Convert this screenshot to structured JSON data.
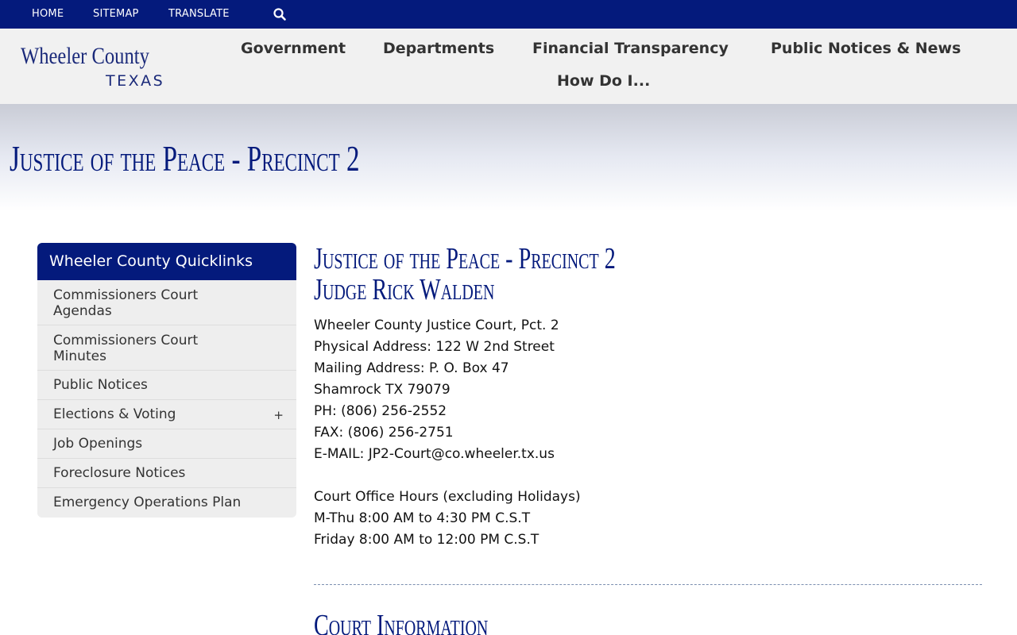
{
  "topbar": {
    "links": [
      "HOME",
      "SITEMAP",
      "TRANSLATE"
    ],
    "search_icon": "search-icon"
  },
  "logo": {
    "line1": "Wheeler County",
    "line2": "TEXAS"
  },
  "nav": {
    "items": [
      "Government",
      "Departments",
      "Financial Transparency",
      "Public Notices & News",
      "How Do I..."
    ]
  },
  "banner": {
    "title": "Justice of the Peace -  Precinct 2"
  },
  "sidebar": {
    "heading": "Wheeler County Quicklinks",
    "items": [
      {
        "label": "Commissioners Court Agendas"
      },
      {
        "label": "Commissioners Court Minutes"
      },
      {
        "label": "Public Notices"
      },
      {
        "label": "Elections & Voting",
        "expand": "+"
      },
      {
        "label": "Job Openings"
      },
      {
        "label": "Foreclosure Notices"
      },
      {
        "label": "Emergency Operations Plan"
      }
    ]
  },
  "main": {
    "title": "Justice of the Peace -  Precinct 2",
    "subtitle": "Judge Rick Walden",
    "contact": [
      "Wheeler County Justice Court, Pct. 2",
      "Physical Address: 122 W 2nd Street",
      "Mailing Address: P. O. Box 47",
      "Shamrock TX 79079",
      "PH: (806) 256-2552",
      "FAX: (806) 256-2751",
      "E-MAIL: JP2-Court@co.wheeler.tx.us"
    ],
    "hours": [
      "Court Office Hours (excluding Holidays)",
      "M-Thu 8:00 AM to 4:30 PM C.S.T",
      "Friday 8:00 AM to 12:00 PM C.S.T"
    ],
    "section_heading": "Court Information"
  },
  "colors": {
    "primary": "#041a7c",
    "header_bg": "#f1f1f1",
    "sidebar_bg": "#eeeeee"
  }
}
